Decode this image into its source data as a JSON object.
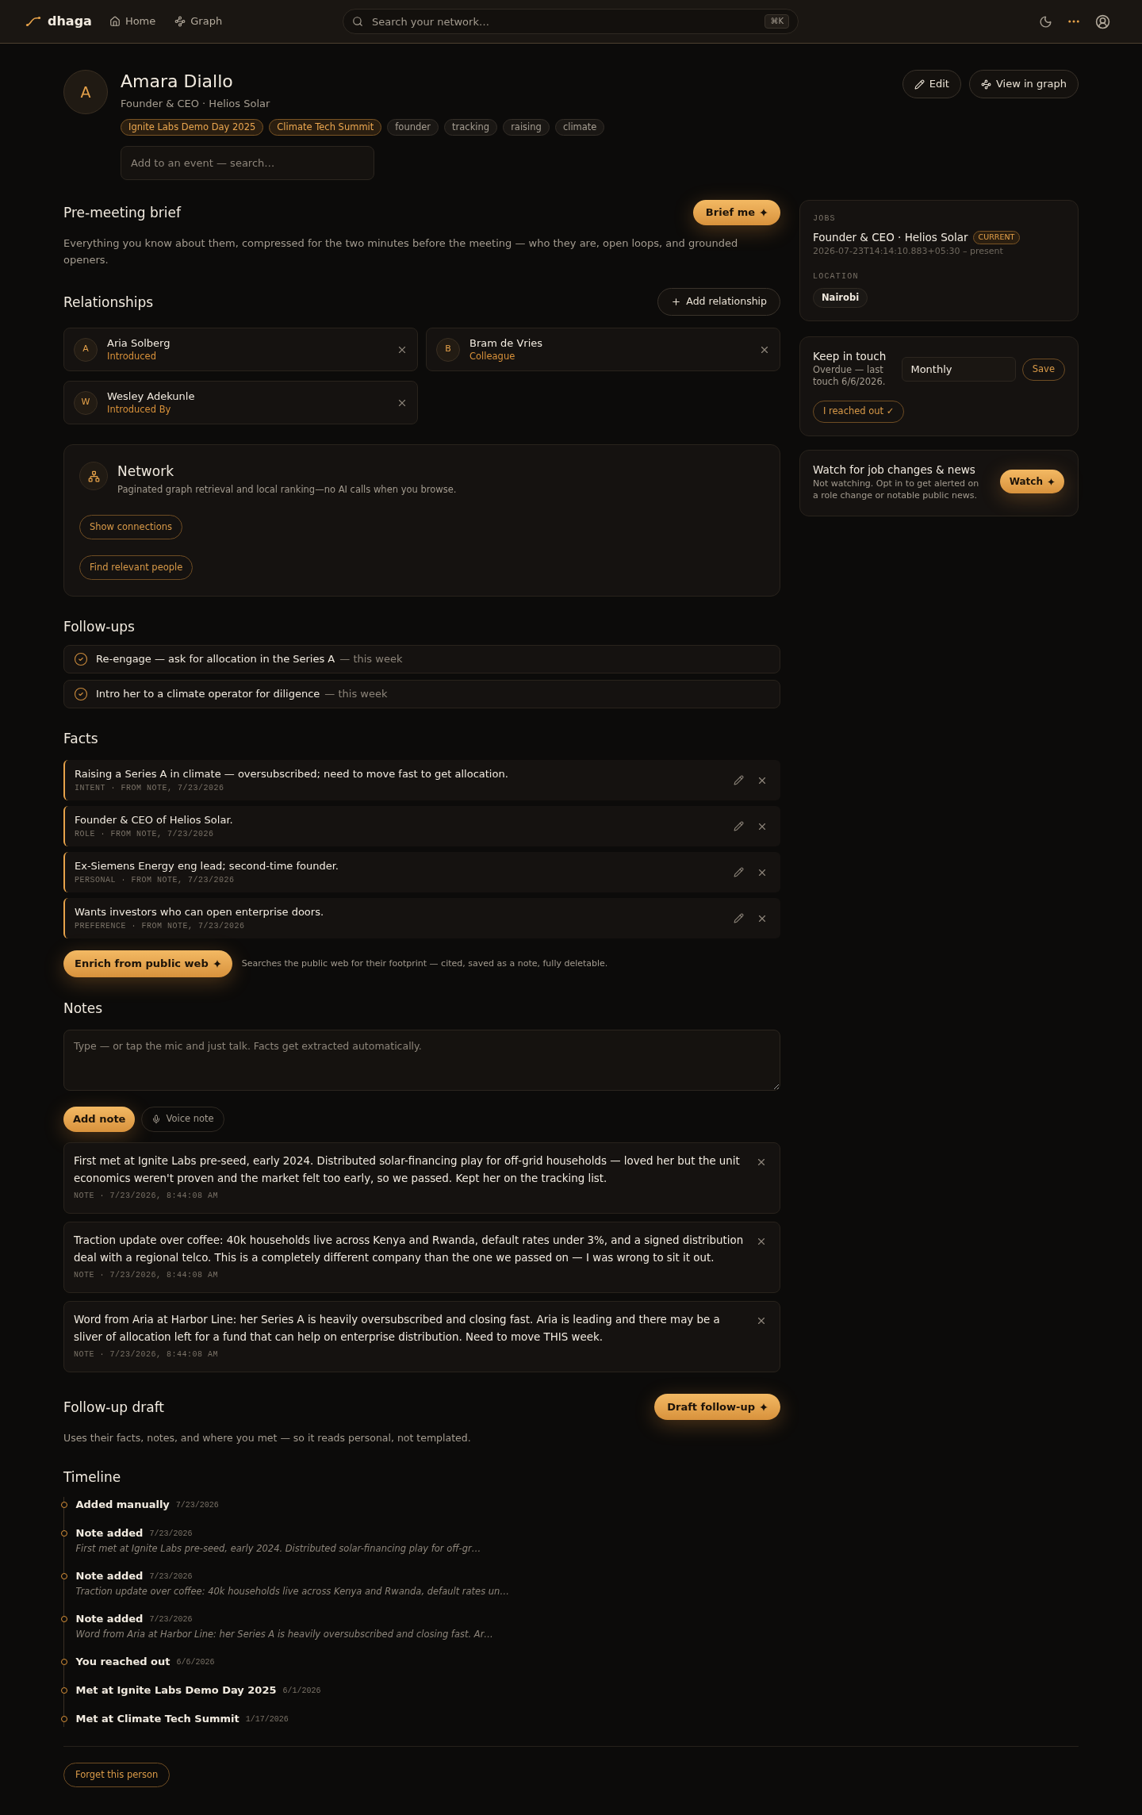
{
  "nav": {
    "brand": "dhaga",
    "links": [
      "Home",
      "Graph"
    ],
    "search": {
      "placeholder": "Search your network…",
      "shortcut": "⌘K"
    }
  },
  "profile": {
    "initial": "A",
    "name": "Amara Diallo",
    "subtitle": "Founder & CEO · Helios Solar",
    "tags": [
      {
        "label": "Ignite Labs Demo Day 2025",
        "kind": "event"
      },
      {
        "label": "Climate Tech Summit",
        "kind": "event"
      },
      {
        "label": "founder",
        "kind": "tag"
      },
      {
        "label": "tracking",
        "kind": "tag"
      },
      {
        "label": "raising",
        "kind": "tag"
      },
      {
        "label": "climate",
        "kind": "tag"
      }
    ],
    "event_search": {
      "placeholder": "Add to an event — search…"
    },
    "actions": [
      "Edit",
      "View in graph"
    ]
  },
  "brief": {
    "title": "Pre-meeting brief",
    "button": "Brief me",
    "description": "Everything you know about them, compressed for the two minutes before the meeting — who they are, open loops, and grounded openers."
  },
  "relationships": {
    "title": "Relationships",
    "add_button": "Add relationship",
    "items": [
      {
        "initial": "A",
        "name": "Aria Solberg",
        "relation": "Introduced"
      },
      {
        "initial": "B",
        "name": "Bram de Vries",
        "relation": "Colleague"
      },
      {
        "initial": "W",
        "name": "Wesley Adekunle",
        "relation": "Introduced By"
      }
    ]
  },
  "network": {
    "title": "Network",
    "description": "Paginated graph retrieval and local ranking—no AI calls when you browse.",
    "buttons": [
      "Show connections",
      "Find relevant people"
    ]
  },
  "follow_ups": {
    "title": "Follow-ups",
    "items": [
      {
        "text": "Re-engage — ask for allocation in the Series A",
        "due": "— this week"
      },
      {
        "text": "Intro her to a climate operator for diligence",
        "due": "— this week"
      }
    ]
  },
  "facts": {
    "title": "Facts",
    "items": [
      {
        "text": "Raising a Series A in climate — oversubscribed; need to move fast to get allocation.",
        "meta": "INTENT · FROM NOTE, 7/23/2026"
      },
      {
        "text": "Founder & CEO of Helios Solar.",
        "meta": "ROLE · FROM NOTE, 7/23/2026"
      },
      {
        "text": "Ex-Siemens Energy eng lead; second-time founder.",
        "meta": "PERSONAL · FROM NOTE, 7/23/2026"
      },
      {
        "text": "Wants investors who can open enterprise doors.",
        "meta": "PREFERENCE · FROM NOTE, 7/23/2026"
      }
    ],
    "enrich_button": "Enrich from public web",
    "enrich_note": "Searches the public web for their footprint — cited, saved as a note, fully deletable."
  },
  "notes": {
    "title": "Notes",
    "input": {
      "placeholder": "Type — or tap the mic and just talk. Facts get extracted automatically."
    },
    "add_button": "Add note",
    "voice_button": "Voice note",
    "items": [
      {
        "text": "First met at Ignite Labs pre-seed, early 2024. Distributed solar-financing play for off-grid households — loved her but the unit economics weren't proven and the market felt too early, so we passed. Kept her on the tracking list.",
        "meta": "NOTE · 7/23/2026, 8:44:08 AM"
      },
      {
        "text": "Traction update over coffee: 40k households live across Kenya and Rwanda, default rates under 3%, and a signed distribution deal with a regional telco. This is a completely different company than the one we passed on — I was wrong to sit it out.",
        "meta": "NOTE · 7/23/2026, 8:44:08 AM"
      },
      {
        "text": "Word from Aria at Harbor Line: her Series A is heavily oversubscribed and closing fast. Aria is leading and there may be a sliver of allocation left for a fund that can help on enterprise distribution. Need to move THIS week.",
        "meta": "NOTE · 7/23/2026, 8:44:08 AM"
      }
    ]
  },
  "follow_up_draft": {
    "title": "Follow-up draft",
    "button": "Draft follow-up",
    "description": "Uses their facts, notes, and where you met — so it reads personal, not templated."
  },
  "timeline": {
    "title": "Timeline",
    "events": [
      {
        "label": "Added manually",
        "date": "7/23/2026"
      },
      {
        "label": "Note added",
        "date": "7/23/2026",
        "excerpt": "First met at Ignite Labs pre-seed, early 2024. Distributed solar-financing play for off-gr…"
      },
      {
        "label": "Note added",
        "date": "7/23/2026",
        "excerpt": "Traction update over coffee: 40k households live across Kenya and Rwanda, default rates un…"
      },
      {
        "label": "Note added",
        "date": "7/23/2026",
        "excerpt": "Word from Aria at Harbor Line: her Series A is heavily oversubscribed and closing fast. Ar…"
      },
      {
        "label": "You reached out",
        "date": "6/6/2026"
      },
      {
        "label": "Met at Ignite Labs Demo Day 2025",
        "date": "6/1/2026"
      },
      {
        "label": "Met at Climate Tech Summit",
        "date": "1/17/2026"
      }
    ]
  },
  "forget_button": "Forget this person",
  "jobs": {
    "label": "JOBS",
    "items": [
      {
        "title": "Founder & CEO · Helios Solar",
        "badge": "CURRENT",
        "dates": "2026-07-23T14:14:10.883+05:30 – present"
      }
    ]
  },
  "location": {
    "label": "LOCATION",
    "value": "Nairobi"
  },
  "keep_in_touch": {
    "title": "Keep in touch",
    "status": "Overdue — last touch 6/6/2026.",
    "frequency": "Monthly",
    "save_button": "Save",
    "reached_button": "I reached out ✓"
  },
  "watch": {
    "title": "Watch for job changes & news",
    "description": "Not watching. Opt in to get alerted on a role change or notable public news.",
    "button": "Watch"
  }
}
